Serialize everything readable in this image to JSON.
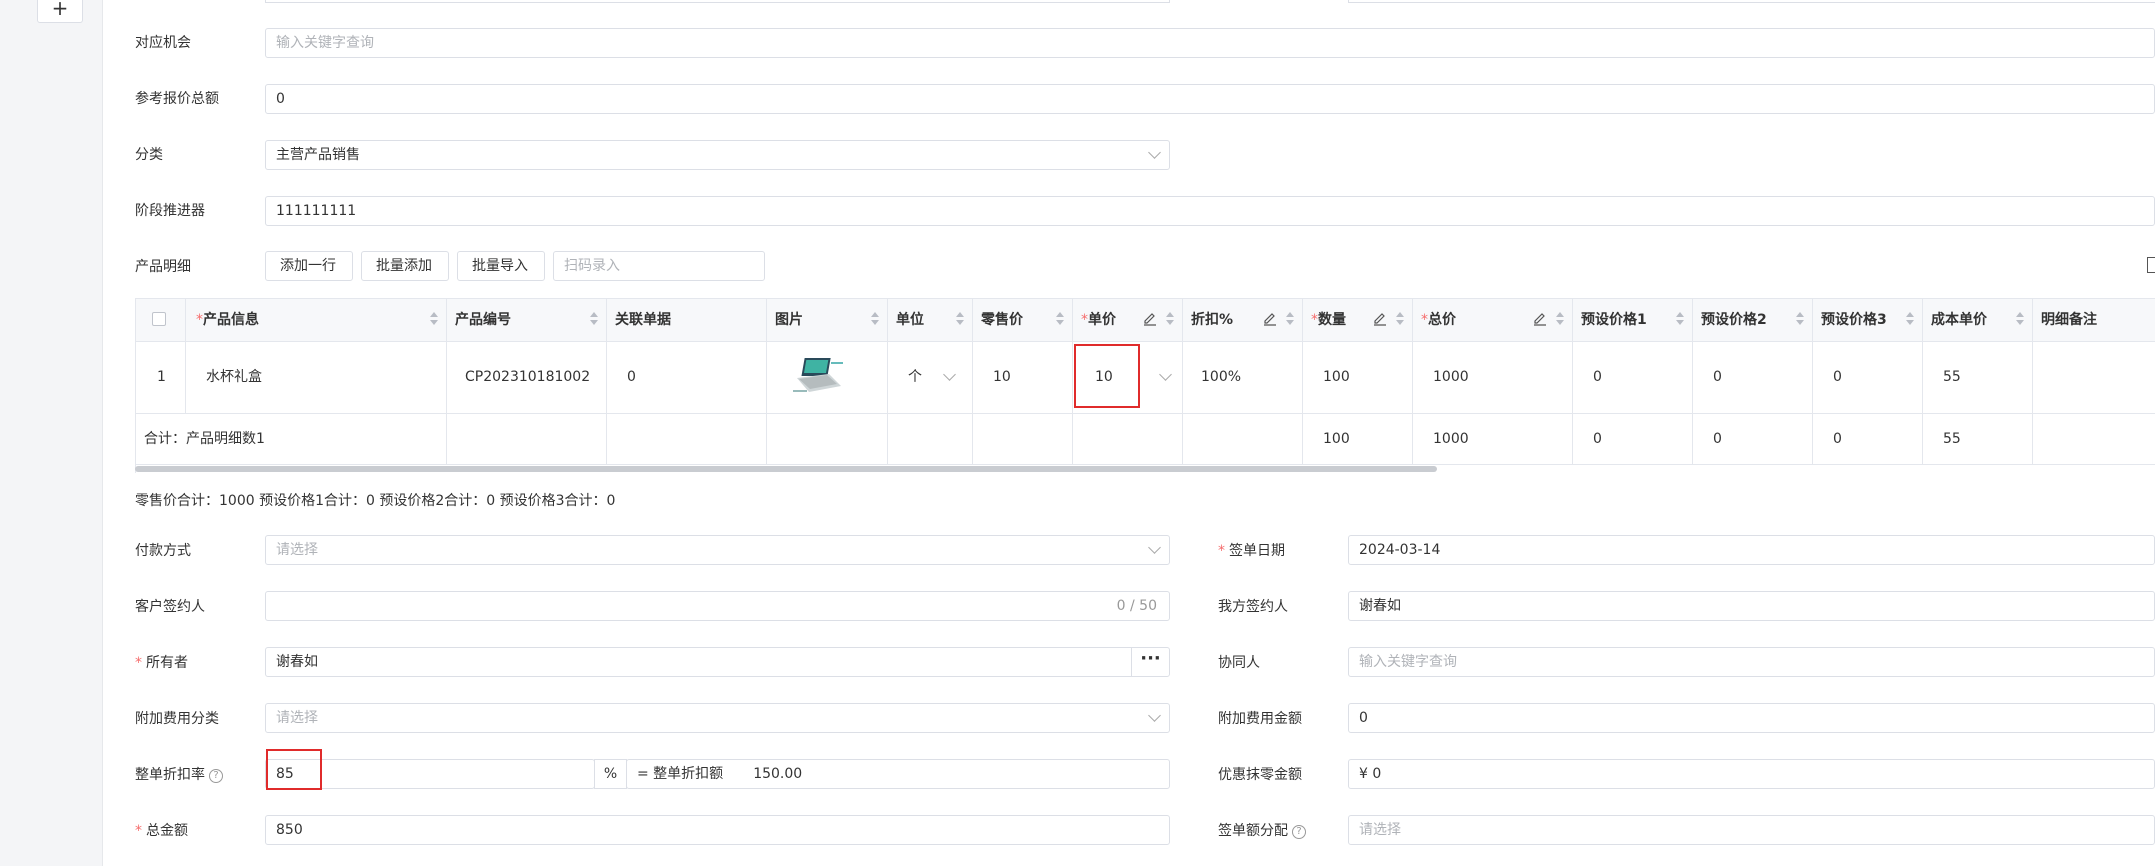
{
  "topbar": {
    "add_tab_icon": "plus-icon",
    "add_label": "+"
  },
  "form": {
    "opportunity": {
      "label": "对应机会",
      "placeholder": "输入关键字查询"
    },
    "ref_total": {
      "label": "参考报价总额",
      "value": "0"
    },
    "category": {
      "label": "分类",
      "value": "主营产品销售"
    },
    "stage": {
      "label": "阶段推进器",
      "value": "111111111"
    },
    "product_detail": {
      "label": "产品明细",
      "add_row": "添加一行",
      "batch_add": "批量添加",
      "batch_import": "批量导入",
      "scan_placeholder": "扫码录入"
    }
  },
  "table": {
    "headers": [
      {
        "label": "产品信息",
        "required": true
      },
      {
        "label": "产品编号"
      },
      {
        "label": "关联单据"
      },
      {
        "label": "图片"
      },
      {
        "label": "单位"
      },
      {
        "label": "零售价"
      },
      {
        "label": "单价",
        "required": true
      },
      {
        "label": "折扣%"
      },
      {
        "label": "数量",
        "required": true
      },
      {
        "label": "总价",
        "required": true
      },
      {
        "label": "预设价格1"
      },
      {
        "label": "预设价格2"
      },
      {
        "label": "预设价格3"
      },
      {
        "label": "成本单价"
      },
      {
        "label": "明细备注"
      }
    ],
    "row": {
      "index": "1",
      "product": "水杯礼盒",
      "code": "CP202310181002",
      "related": "0",
      "unit": "个",
      "retail": "10",
      "unit_price": "10",
      "discount": "100%",
      "qty": "100",
      "total": "1000",
      "p1": "0",
      "p2": "0",
      "p3": "0",
      "cost": "55",
      "remark": ""
    },
    "sum": {
      "label": "合计：产品明细数1",
      "qty": "100",
      "total": "1000",
      "p1": "0",
      "p2": "0",
      "p3": "0",
      "cost": "55"
    }
  },
  "summary_text": "零售价合计：1000  预设价格1合计：0  预设价格2合计：0  预设价格3合计：0",
  "fields": {
    "payment": {
      "label": "付款方式",
      "placeholder": "请选择"
    },
    "sign_date": {
      "label": "签单日期",
      "value": "2024-03-14"
    },
    "customer_signer": {
      "label": "客户签约人",
      "counter": "0 / 50"
    },
    "our_signer": {
      "label": "我方签约人",
      "value": "谢春如"
    },
    "owner": {
      "label": "所有者",
      "value": "谢春如",
      "more": "···"
    },
    "collaborator": {
      "label": "协同人",
      "placeholder": "输入关键字查询"
    },
    "extra_fee_cat": {
      "label": "附加费用分类",
      "placeholder": "请选择"
    },
    "extra_fee_amt": {
      "label": "附加费用金额",
      "value": "0"
    },
    "discount_rate": {
      "label": "整单折扣率",
      "value": "85",
      "unit": "%",
      "result_label": "= 整单折扣额",
      "result_value": "150.00"
    },
    "rounding": {
      "label": "优惠抹零金额",
      "value": "¥ 0"
    },
    "total": {
      "label": "总金额",
      "value": "850"
    },
    "allocation": {
      "label": "签单额分配",
      "placeholder": "请选择"
    }
  },
  "colors": {
    "required": "#f56c6c",
    "highlight": "#e02b2b",
    "border": "#dcdfe6"
  }
}
